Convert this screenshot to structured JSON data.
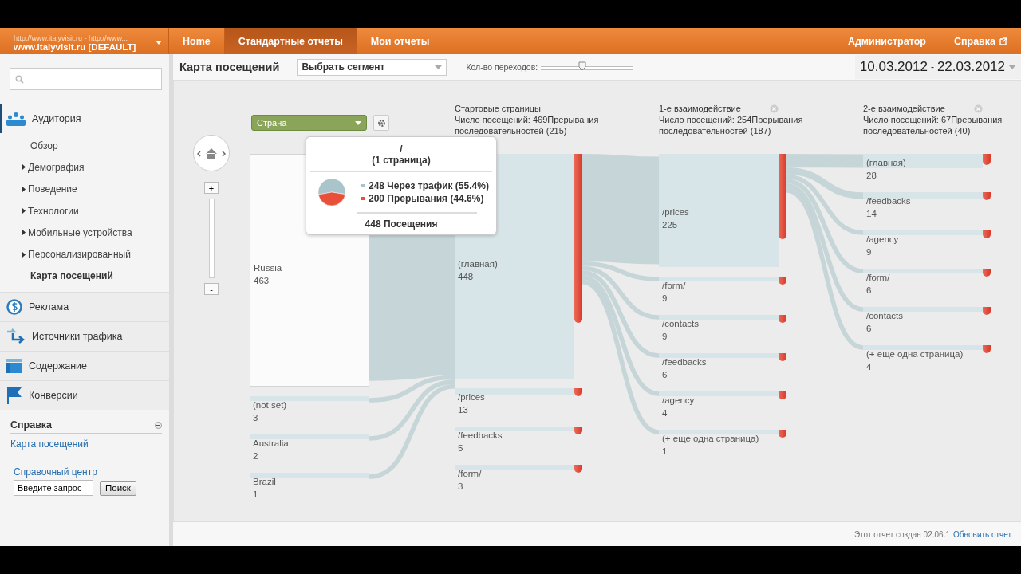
{
  "header": {
    "account_url": "http://www.italyvisit.ru - http://www...",
    "account_name": "www.italyvisit.ru [DEFAULT]",
    "tabs": [
      {
        "label": "Home",
        "selected": false
      },
      {
        "label": "Стандартные отчеты",
        "selected": true
      },
      {
        "label": "Мои отчеты",
        "selected": false
      }
    ],
    "right_links": [
      {
        "label": "Администратор",
        "external": false
      },
      {
        "label": "Справка",
        "external": true
      }
    ]
  },
  "sidebar": {
    "sections": [
      {
        "label": "Аудитория",
        "expanded": true,
        "children": [
          {
            "label": "Обзор",
            "has_children": false,
            "selected": false
          },
          {
            "label": "Демография",
            "has_children": true,
            "selected": false
          },
          {
            "label": "Поведение",
            "has_children": true,
            "selected": false
          },
          {
            "label": "Технологии",
            "has_children": true,
            "selected": false
          },
          {
            "label": "Мобильные устройства",
            "has_children": true,
            "selected": false
          },
          {
            "label": "Персонализированный",
            "has_children": true,
            "selected": false
          },
          {
            "label": "Карта посещений",
            "has_children": false,
            "selected": true
          }
        ]
      },
      {
        "label": "Реклама",
        "expanded": false
      },
      {
        "label": "Источники трафика",
        "expanded": false
      },
      {
        "label": "Содержание",
        "expanded": false
      },
      {
        "label": "Конверсии",
        "expanded": false
      }
    ],
    "help": {
      "title": "Справка",
      "link": "Карта посещений",
      "center": "Справочный центр",
      "query": "Введите запрос",
      "button": "Поиск"
    }
  },
  "toolbar": {
    "title": "Карта посещений",
    "segment": "Выбрать сегмент",
    "steps": {
      "label": "Кол-во переходов:",
      "level": 0.45
    },
    "date_from": "10.03.2012",
    "date_sep": "-",
    "date_to": "22.03.2012"
  },
  "flow": {
    "zoom": {
      "in": "+",
      "out": "-"
    },
    "columns": [
      {
        "kind": "dimension",
        "select": "Страна",
        "nodes": [
          {
            "label": "Russia",
            "count": "463"
          },
          {
            "label": "(not set)",
            "count": "3"
          },
          {
            "label": "Australia",
            "count": "2"
          },
          {
            "label": "Brazil",
            "count": "1"
          }
        ]
      },
      {
        "kind": "pages",
        "title": "Стартовые страницы",
        "stats": "Число посещений: 469Прерывания последовательностей (215)",
        "removable": false,
        "nodes": [
          {
            "label": "(главная)",
            "count": "448"
          },
          {
            "label": "/prices",
            "count": "13"
          },
          {
            "label": "/feedbacks",
            "count": "5"
          },
          {
            "label": "/form/",
            "count": "3"
          }
        ]
      },
      {
        "kind": "pages",
        "title": "1-е взаимодействие",
        "stats": "Число посещений: 254Прерывания последовательностей (187)",
        "removable": true,
        "nodes": [
          {
            "label": "/prices",
            "count": "225"
          },
          {
            "label": "/form/",
            "count": "9"
          },
          {
            "label": "/contacts",
            "count": "9"
          },
          {
            "label": "/feedbacks",
            "count": "6"
          },
          {
            "label": "/agency",
            "count": "4"
          },
          {
            "label": "(+ еще одна страница)",
            "count": "1"
          }
        ]
      },
      {
        "kind": "pages",
        "title": "2-е взаимодействие",
        "stats": "Число посещений: 67Прерывания последовательностей (40)",
        "removable": true,
        "nodes": [
          {
            "label": "(главная)",
            "count": "28"
          },
          {
            "label": "/feedbacks",
            "count": "14"
          },
          {
            "label": "/agency",
            "count": "9"
          },
          {
            "label": "/form/",
            "count": "6"
          },
          {
            "label": "/contacts",
            "count": "6"
          },
          {
            "label": "(+ еще одна страница)",
            "count": "4"
          }
        ]
      }
    ],
    "tooltip": {
      "title": "/",
      "subtitle": "(1 страница)",
      "legend": [
        {
          "text": "248 Через трафик (55.4%)",
          "color": "#a9c4cb"
        },
        {
          "text": "200 Прерывания (44.6%)",
          "color": "#e8503a"
        }
      ],
      "chart_data": {
        "type": "pie",
        "values": [
          55.4,
          44.6
        ]
      },
      "total": "448 Посещения"
    }
  },
  "footer": {
    "created": "Этот отчет создан 02.06.1",
    "refresh": "Обновить отчет"
  }
}
